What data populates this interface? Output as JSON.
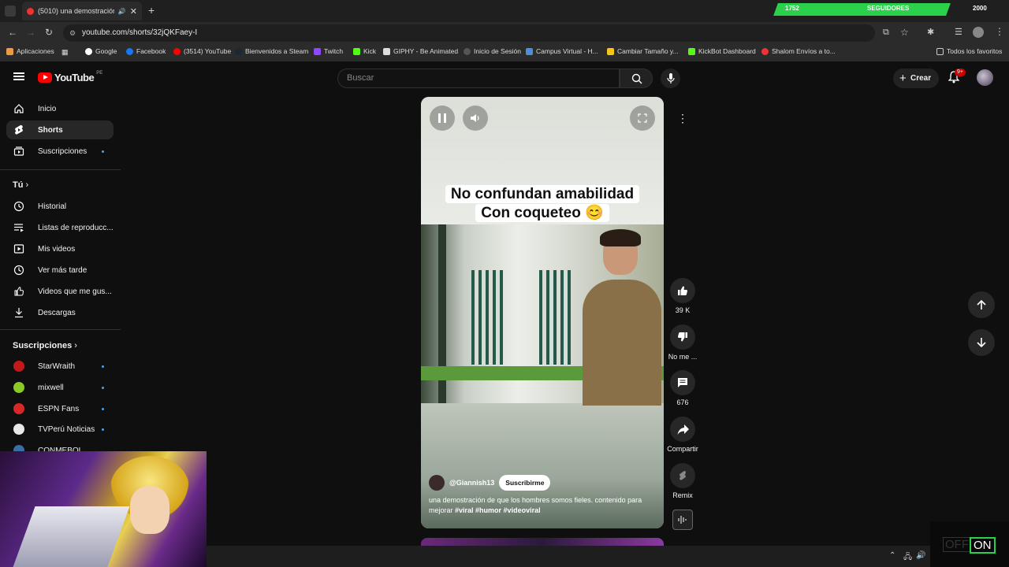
{
  "browser": {
    "tab_title": "(5010) una demostración de",
    "url": "youtube.com/shorts/32jQKFaey-I",
    "bookmarks": [
      "Aplicaciones",
      "Google",
      "Facebook",
      "(3514) YouTube",
      "Bienvenidos a Steam",
      "Twitch",
      "Kick",
      "GIPHY - Be Animated",
      "Inicio de Sesión",
      "Campus Virtual - H...",
      "Cambiar Tamaño y...",
      "KickBot Dashboard",
      "Shalom Envíos a to..."
    ],
    "all_bookmarks": "Todos los favoritos"
  },
  "follower_goal": {
    "current": "1752",
    "label": "SEGUIDORES",
    "goal": "2000",
    "progress": 0.876
  },
  "header": {
    "logo": "YouTube",
    "region": "PE",
    "search_placeholder": "Buscar",
    "create_label": "Crear",
    "notif_badge": "9+"
  },
  "sidebar": {
    "main": [
      {
        "label": "Inicio",
        "icon": "home-icon"
      },
      {
        "label": "Shorts",
        "icon": "shorts-icon",
        "active": true
      },
      {
        "label": "Suscripciones",
        "icon": "subscriptions-icon"
      }
    ],
    "you_heading": "Tú",
    "you": [
      {
        "label": "Historial",
        "icon": "history-icon"
      },
      {
        "label": "Listas de reproducc...",
        "icon": "playlists-icon"
      },
      {
        "label": "Mis videos",
        "icon": "my-videos-icon"
      },
      {
        "label": "Ver más tarde",
        "icon": "watch-later-icon"
      },
      {
        "label": "Videos que me gus...",
        "icon": "liked-icon"
      },
      {
        "label": "Descargas",
        "icon": "download-icon"
      }
    ],
    "subs_heading": "Suscripciones",
    "subs": [
      {
        "label": "StarWraith",
        "color": "#c21a1a"
      },
      {
        "label": "mixwell",
        "color": "#8ac926"
      },
      {
        "label": "ESPN Fans",
        "color": "#d62828"
      },
      {
        "label": "TVPerú Noticias",
        "color": "#e8e8e8"
      },
      {
        "label": "CONMEBOL",
        "color": "#3a6ea5"
      }
    ]
  },
  "short": {
    "caption_line1": "No confundan amabilidad",
    "caption_line2": "Con coqueteo 😊",
    "channel": "@Giannish13",
    "subscribe": "Suscribirme",
    "description": "una demostración de que los hombres somos fieles. contenido para mejorar",
    "hashtags": "#viral #humor #videoviral"
  },
  "actions": {
    "likes": "39 K",
    "dislike": "No me ...",
    "comments": "676",
    "share": "Compartir",
    "remix": "Remix"
  },
  "overlay": {
    "off": "OFF",
    "on": "ON"
  },
  "colors": {
    "accent_blue": "#3ea6ff",
    "yt_red": "#ff0000",
    "goal_green": "#2bd14a"
  }
}
